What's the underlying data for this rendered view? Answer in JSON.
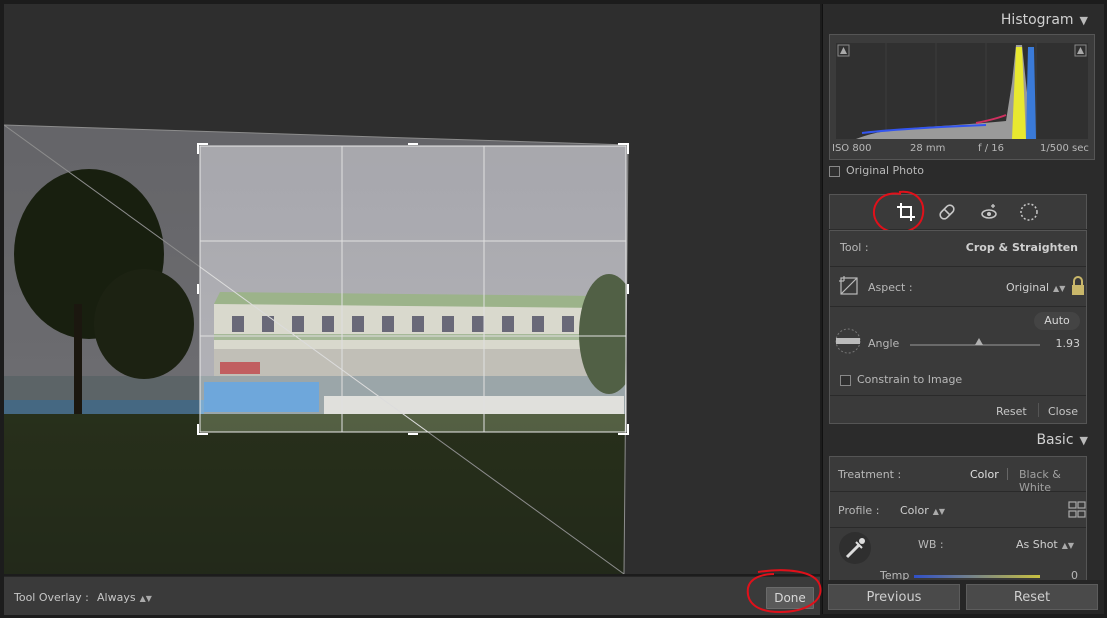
{
  "toolbar": {
    "tool_overlay_label": "Tool Overlay :",
    "tool_overlay_value": "Always",
    "done_label": "Done"
  },
  "histogram": {
    "title": "Histogram",
    "iso": "ISO 800",
    "focal_length": "28 mm",
    "aperture": "f / 16",
    "shutter": "1/500 sec",
    "original_photo_label": "Original Photo"
  },
  "crop_tool": {
    "tool_label": "Tool :",
    "tool_value": "Crop & Straighten",
    "aspect_label": "Aspect :",
    "aspect_value": "Original",
    "auto_label": "Auto",
    "angle_label": "Angle",
    "angle_value": "1.93",
    "constrain_label": "Constrain to Image",
    "reset_label": "Reset",
    "close_label": "Close"
  },
  "basic": {
    "title": "Basic",
    "treatment_label": "Treatment :",
    "treatment_color": "Color",
    "treatment_bw": "Black & White",
    "profile_label": "Profile :",
    "profile_value": "Color",
    "wb_label": "WB :",
    "wb_value": "As Shot",
    "temp_label": "Temp",
    "temp_value": "0"
  },
  "nav": {
    "previous_label": "Previous",
    "reset_label": "Reset"
  },
  "colors": {
    "panel_bg": "#2b2b2b",
    "section_bg": "#3a3a3a",
    "annotation_red": "#e0101a"
  }
}
